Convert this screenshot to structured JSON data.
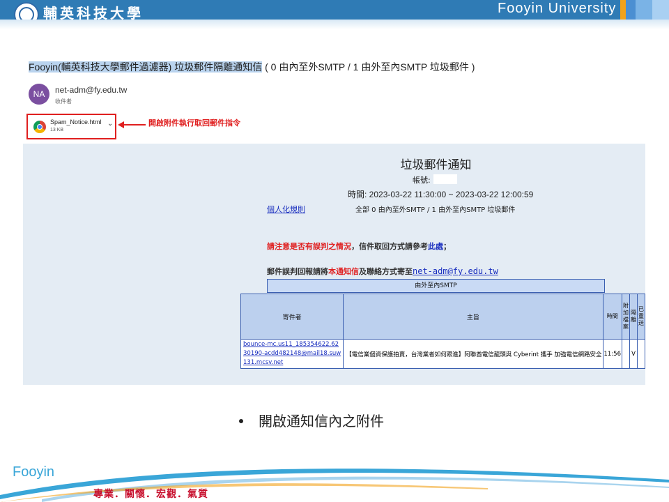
{
  "header": {
    "chinese_name": "輔英科技大學",
    "english_name": "Fooyin University",
    "logo_icon": "university-seal-icon"
  },
  "email": {
    "subject_highlight": "Fooyin(輔英科技大學郵件過濾器) 垃圾郵件隔離通知信",
    "subject_rest": " ( 0 由內至外SMTP / 1 由外至內SMTP 垃圾郵件 )",
    "avatar_initials": "NA",
    "sender": "net-adm@fy.edu.tw",
    "recipient_label": "收件者",
    "attachment": {
      "name": "Spam_Notice.html",
      "size": "13 KB",
      "icon": "chrome-icon"
    },
    "annotation": "開啟附件執行取回郵件指令"
  },
  "notice": {
    "title": "垃圾郵件通知",
    "account_label": "帳號:",
    "time": "時間: 2023-03-22 11:30:00 ~ 2023-03-22 12:00:59",
    "rules_link": "個人化規則",
    "summary": "全部  0 由內至外SMTP / 1 由外至內SMTP  垃圾郵件",
    "warn_red": "請注意是否有誤判之情況",
    "warn_mid": "，信件取回方式請參考",
    "warn_link": "此處",
    "warn_end": "；",
    "report_pre": "郵件誤判回報請將",
    "report_red": "本通知信",
    "report_mid": "及聯絡方式寄至",
    "report_mail": "net-adm@fy.edu.tw",
    "direction": "由外至內SMTP",
    "columns": {
      "sender": "寄件者",
      "subject": "主旨",
      "time": "時間",
      "c1": "附加檔案",
      "c2": "隔離",
      "c3": "已重送"
    },
    "row": {
      "sender": "bounce-mc.us11_185354622.6230190-acdd482148@mail18.suw131.mcsv.net",
      "subject": "【電信業個資保護拍賣，台灣業者如何跟進】阿聯酋電信龍頭與 Cyberint 攜手 加強電信網路安全",
      "time": "11:56",
      "c2": "V"
    }
  },
  "slide": {
    "bullet": "開啟通知信內之附件",
    "footer_brand": "Fooyin",
    "slogan": "專業．關懷．宏觀．氣質"
  },
  "colors": {
    "banner": "#2f7bb5",
    "highlight": "#e01f1f",
    "link": "#1a2fbf"
  }
}
